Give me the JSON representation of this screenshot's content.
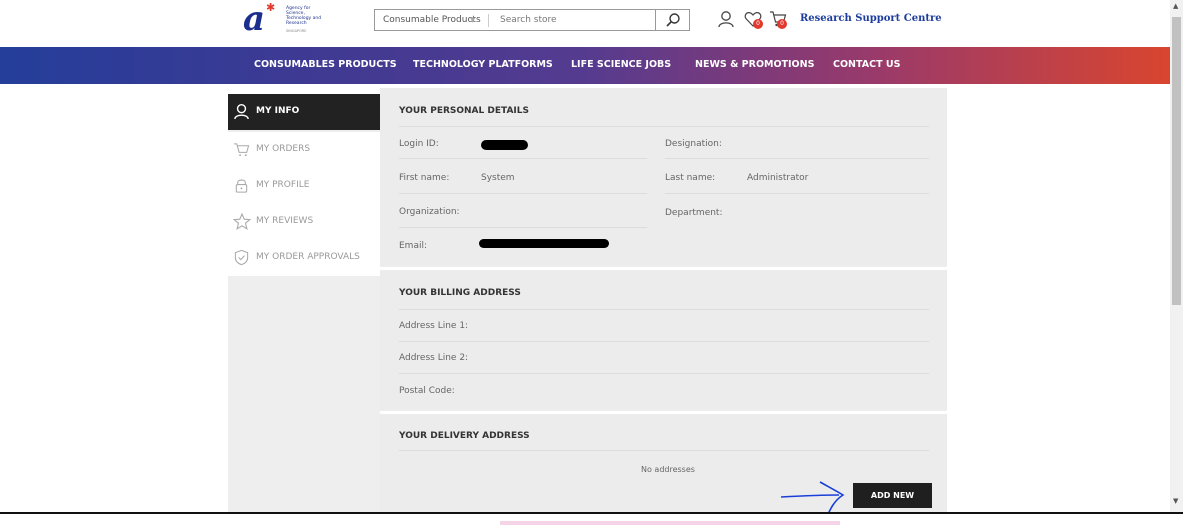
{
  "header": {
    "logo_tagline": "Agency for Science, Technology and Research",
    "logo_country": "SINGAPORE",
    "search_category": "Consumable Products",
    "search_placeholder": "Search store",
    "wishlist_count": "0",
    "cart_count": "0",
    "research_support": "Research Support Centre"
  },
  "nav": {
    "items": [
      "CONSUMABLES PRODUCTS",
      "TECHNOLOGY PLATFORMS",
      "LIFE SCIENCE JOBS",
      "NEWS & PROMOTIONS",
      "CONTACT US"
    ]
  },
  "sidebar": {
    "items": [
      "MY INFO",
      "MY ORDERS",
      "MY PROFILE",
      "MY REVIEWS",
      "MY ORDER APPROVALS"
    ]
  },
  "personal": {
    "title": "YOUR PERSONAL DETAILS",
    "login_label": "Login ID:",
    "designation_label": "Designation:",
    "first_name_label": "First name:",
    "first_name": "System",
    "last_name_label": "Last name:",
    "last_name": "Administrator",
    "organization_label": "Organization:",
    "department_label": "Department:",
    "email_label": "Email:"
  },
  "billing": {
    "title": "YOUR BILLING ADDRESS",
    "line1_label": "Address Line 1:",
    "line2_label": "Address Line 2:",
    "postal_label": "Postal Code:"
  },
  "delivery": {
    "title": "YOUR DELIVERY ADDRESS",
    "empty_text": "No addresses",
    "add_new_label": "ADD NEW"
  },
  "colors": {
    "nav_start": "#243e9a",
    "nav_end": "#d9452f",
    "accent_red": "#e03a2f",
    "dark_button": "#1f1f1f",
    "annotation_blue": "#1a3fd8"
  }
}
